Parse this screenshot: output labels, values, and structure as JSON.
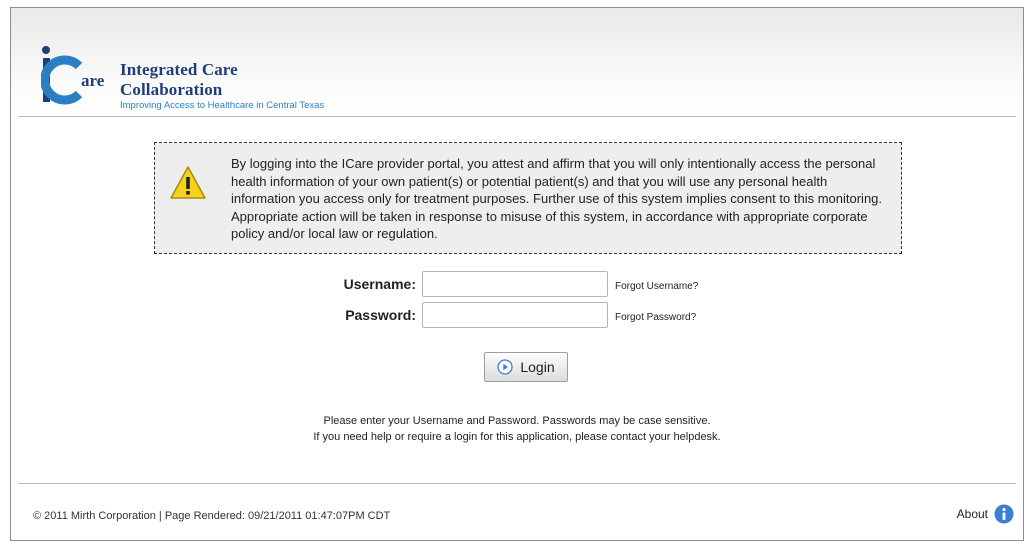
{
  "header": {
    "logo_title": "Integrated Care Collaboration",
    "logo_subtitle": "Improving Access to Healthcare in Central Texas",
    "logo_mark": "are"
  },
  "notice": {
    "icon": "warning-icon",
    "text": "By logging into the ICare provider portal, you attest and affirm that you will only intentionally access the personal health information of your own patient(s) or potential patient(s) and that you will use any personal health information you access only for treatment purposes. Further use of this system implies consent to this monitoring. Appropriate action will be taken in response to misuse of this system, in accordance with appropriate corporate policy and/or local law or regulation."
  },
  "form": {
    "username_label": "Username:",
    "username_value": "",
    "forgot_username": "Forgot Username?",
    "password_label": "Password:",
    "password_value": "",
    "forgot_password": "Forgot Password?",
    "login_label": "Login"
  },
  "help": {
    "line1": "Please enter your Username and Password. Passwords may be case sensitive.",
    "line2": "If you need help or require a login for this application, please contact your helpdesk."
  },
  "footer": {
    "copyright": "© 2011 Mirth Corporation | Page Rendered: 09/21/2011 01:47:07PM CDT",
    "about_label": "About"
  },
  "colors": {
    "logo_navy": "#1f3d78",
    "logo_blue": "#2a7fc4",
    "warning_yellow": "#f7d21c",
    "info_blue": "#3b7fd4"
  }
}
